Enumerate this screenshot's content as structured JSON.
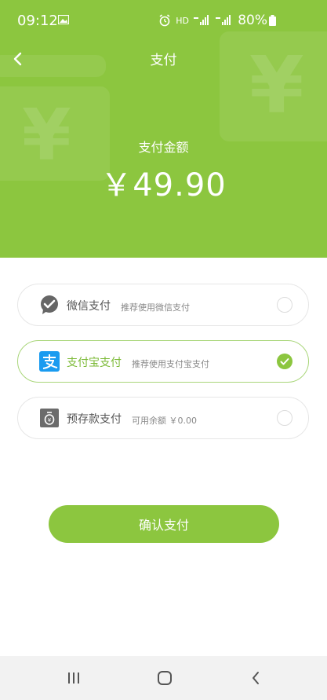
{
  "status_bar": {
    "time": "09:12",
    "network": "HD",
    "battery": "80%"
  },
  "header": {
    "title": "支付"
  },
  "payment": {
    "amount_label": "支付金额",
    "amount": "￥49.90"
  },
  "options": [
    {
      "name": "微信支付",
      "desc": "推荐使用微信支付",
      "selected": false,
      "icon": "wechat-pay-icon"
    },
    {
      "name": "支付宝支付",
      "desc": "推荐使用支付宝支付",
      "selected": true,
      "icon": "alipay-icon"
    },
    {
      "name": "预存款支付",
      "desc": "可用余额 ￥0.00",
      "selected": false,
      "icon": "wallet-icon"
    }
  ],
  "actions": {
    "confirm": "确认支付"
  },
  "colors": {
    "primary": "#8cc63f",
    "selected_text": "#7cba37",
    "border": "#e6e6e6"
  }
}
